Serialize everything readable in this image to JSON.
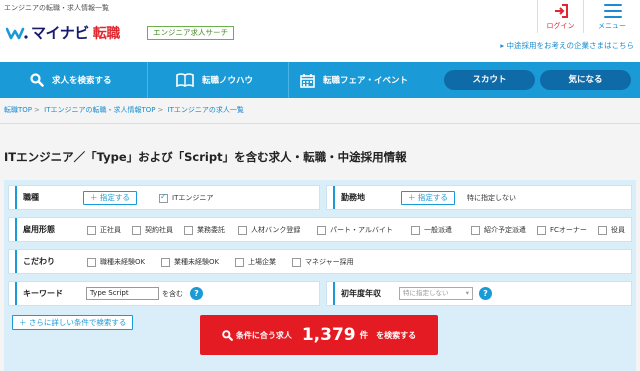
{
  "header": {
    "tagline": "エンジニアの転職・求人情報一覧",
    "logo_text": "マイナビ",
    "logo_suffix": "転職",
    "badge": "エンジニア求人サーチ",
    "login_label": "ログイン",
    "menu_label": "メニュー",
    "recruiter_link": "中途採用をお考えの企業さまはこちら"
  },
  "nav": {
    "search_label": "求人を検索する",
    "knowhow_label": "転職ノウハウ",
    "fair_label": "転職フェア・イベント",
    "scout_label": "スカウト",
    "favorite_label": "気になる"
  },
  "breadcrumb": [
    "転職TOP",
    "ITエンジニアの転職・求人情報TOP",
    "ITエンジニアの求人一覧"
  ],
  "page_title": "ITエンジニア／「Type」および「Script」を含む求人・転職・中途採用情報",
  "search_panel": {
    "occupation": {
      "label": "職種",
      "button": "＋ 指定する",
      "selected": "ITエンジニア"
    },
    "location": {
      "label": "勤務地",
      "button": "＋ 指定する",
      "value": "特に指定しない"
    },
    "employment": {
      "label": "雇用形態",
      "options": [
        "正社員",
        "契約社員",
        "業務委託",
        "人材バンク登録",
        "パート・アルバイト",
        "一般派遣",
        "紹介予定派遣",
        "FCオーナー",
        "役員"
      ]
    },
    "preferences": {
      "label": "こだわり",
      "options": [
        "職種未経験OK",
        "業種未経験OK",
        "上場企業",
        "マネジャー採用"
      ]
    },
    "keyword": {
      "label": "キーワード",
      "value": "Type Script",
      "suffix": "を含む",
      "help": "?"
    },
    "salary": {
      "label": "初年度年収",
      "selected": "特に指定しない",
      "help": "?"
    },
    "detail_button": "＋ さらに詳しい条件で検索する",
    "submit": {
      "prefix": "条件に合う求人",
      "count": "1,379",
      "unit": "件",
      "suffix": "を検索する"
    }
  },
  "colors": {
    "primary_blue": "#1a9ad6",
    "dark_blue_pill": "#0f6aa8",
    "cta_red": "#e41b23",
    "brand_navy": "#1a1a6e"
  }
}
